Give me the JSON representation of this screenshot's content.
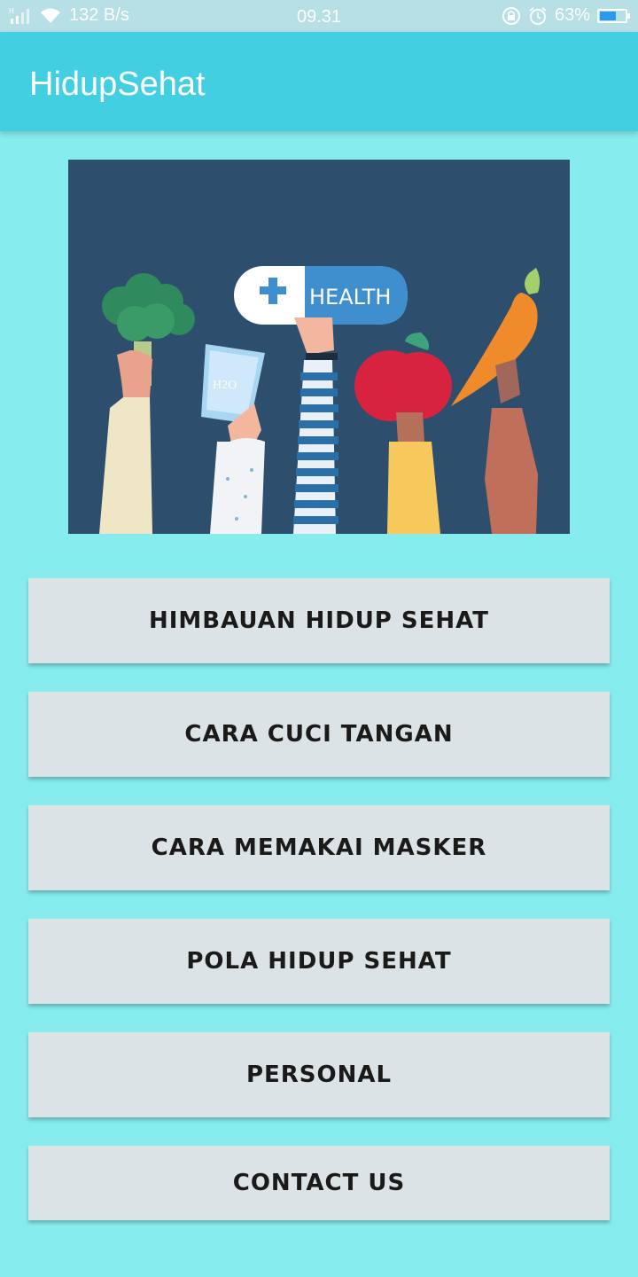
{
  "status_bar": {
    "network_speed": "132 B/s",
    "time": "09.31",
    "battery": "63%",
    "battery_level": 0.63,
    "icons": [
      "signal-icon",
      "wifi-icon",
      "rotation-lock-icon",
      "alarm-icon",
      "battery-icon"
    ]
  },
  "app_bar": {
    "title": "HidupSehat"
  },
  "hero": {
    "badge_text": "HEALTH",
    "glass_text": "H2O"
  },
  "menu": {
    "himbauan": "HIMBAUAN HIDUP SEHAT",
    "cuci_tangan": "CARA CUCI TANGAN",
    "masker": "CARA MEMAKAI MASKER",
    "pola": "POLA HIDUP SEHAT",
    "personal": "PERSONAL",
    "contact": "CONTACT US"
  },
  "colors": {
    "background": "#87ecee",
    "app_bar": "#42cfe2",
    "button": "#dbe3e6",
    "hero_bg": "#2d4f6d"
  }
}
